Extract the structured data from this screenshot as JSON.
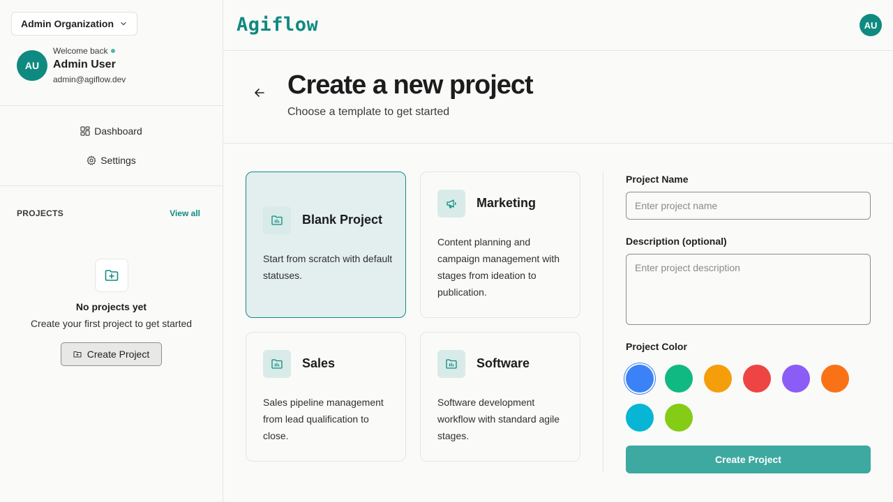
{
  "org": {
    "name": "Admin Organization"
  },
  "user": {
    "welcome": "Welcome back",
    "name": "Admin User",
    "email": "admin@agiflow.dev",
    "initials": "AU"
  },
  "nav": {
    "dashboard": "Dashboard",
    "settings": "Settings"
  },
  "projects": {
    "label": "PROJECTS",
    "view_all": "View all",
    "empty_title": "No projects yet",
    "empty_sub": "Create your first project to get started",
    "create_label": "Create Project"
  },
  "brand": {
    "logo": "Agiflow",
    "accent": "#0f8a80"
  },
  "page": {
    "title": "Create a new project",
    "subtitle": "Choose a template to get started"
  },
  "templates": [
    {
      "title": "Blank Project",
      "description": "Start from scratch with default statuses.",
      "icon": "folder-chart-icon",
      "selected": true
    },
    {
      "title": "Marketing",
      "description": "Content planning and campaign management with stages from ideation to publication.",
      "icon": "megaphone-icon",
      "selected": false
    },
    {
      "title": "Sales",
      "description": "Sales pipeline management from lead qualification to close.",
      "icon": "folder-chart-icon",
      "selected": false
    },
    {
      "title": "Software",
      "description": "Software development workflow with standard agile stages.",
      "icon": "folder-chart-icon",
      "selected": false
    }
  ],
  "form": {
    "name_label": "Project Name",
    "name_placeholder": "Enter project name",
    "desc_label": "Description (optional)",
    "desc_placeholder": "Enter project description",
    "color_label": "Project Color",
    "colors": [
      "#3b82f6",
      "#10b981",
      "#f59e0b",
      "#ef4444",
      "#8b5cf6",
      "#f97316",
      "#06b6d4",
      "#84cc16"
    ],
    "selected_color": "#3b82f6",
    "submit_label": "Create Project"
  }
}
